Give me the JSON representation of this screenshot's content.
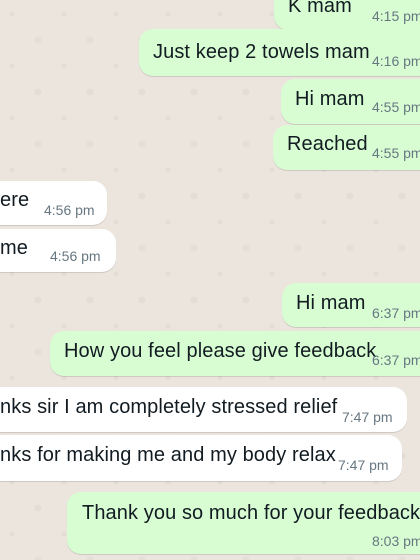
{
  "chat": {
    "messages": [
      {
        "direction": "outgoing",
        "text": "K mam",
        "time": "4:15 pm"
      },
      {
        "direction": "outgoing",
        "text": "Just keep 2 towels mam",
        "time": "4:16 pm"
      },
      {
        "direction": "outgoing",
        "text": "Hi mam",
        "time": "4:55 pm"
      },
      {
        "direction": "outgoing",
        "text": "Reached",
        "time": "4:55 pm"
      },
      {
        "direction": "incoming",
        "text": "ere",
        "time": "4:56 pm"
      },
      {
        "direction": "incoming",
        "text": "me",
        "time": "4:56 pm"
      },
      {
        "direction": "outgoing",
        "text": "Hi mam",
        "time": "6:37 pm"
      },
      {
        "direction": "outgoing",
        "text": "How you feel please give feedback",
        "time": "6:37 pm"
      },
      {
        "direction": "incoming",
        "text": "nks sir I am completely stressed relief",
        "time": "7:47 pm"
      },
      {
        "direction": "incoming",
        "text": "nks for making me and my body relax",
        "time": "7:47 pm"
      },
      {
        "direction": "outgoing",
        "text": "Thank you so much for your feedback m",
        "time": "8:03 pm"
      }
    ]
  },
  "colors": {
    "outgoing_bubble": "#d9fdd3",
    "incoming_bubble": "#ffffff",
    "wallpaper": "#ebe5de",
    "message_text": "#111b21",
    "timestamp_text": "#667781"
  }
}
